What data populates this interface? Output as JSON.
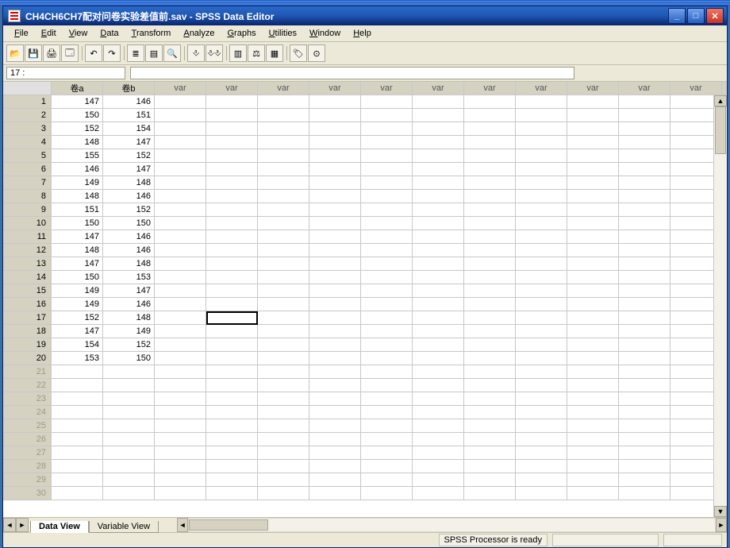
{
  "title": "CH4CH6CH7配对问卷实验差值前.sav - SPSS Data Editor",
  "menus": [
    "File",
    "Edit",
    "View",
    "Data",
    "Transform",
    "Analyze",
    "Graphs",
    "Utilities",
    "Window",
    "Help"
  ],
  "cellref": "17 :",
  "columns": [
    "卷a",
    "卷b"
  ],
  "extra_var_cols": 12,
  "extra_var_label": "var",
  "rows": [
    {
      "a": 147,
      "b": 146
    },
    {
      "a": 150,
      "b": 151
    },
    {
      "a": 152,
      "b": 154
    },
    {
      "a": 148,
      "b": 147
    },
    {
      "a": 155,
      "b": 152
    },
    {
      "a": 146,
      "b": 147
    },
    {
      "a": 149,
      "b": 148
    },
    {
      "a": 148,
      "b": 146
    },
    {
      "a": 151,
      "b": 152
    },
    {
      "a": 150,
      "b": 150
    },
    {
      "a": 147,
      "b": 146
    },
    {
      "a": 148,
      "b": 146
    },
    {
      "a": 147,
      "b": 148
    },
    {
      "a": 150,
      "b": 153
    },
    {
      "a": 149,
      "b": 147
    },
    {
      "a": 149,
      "b": 146
    },
    {
      "a": 152,
      "b": 148
    },
    {
      "a": 147,
      "b": 149
    },
    {
      "a": 154,
      "b": 152
    },
    {
      "a": 153,
      "b": 150
    }
  ],
  "empty_rows_after": 10,
  "selected_cell": {
    "row": 17,
    "col": 4
  },
  "tabs": {
    "active": "Data View",
    "inactive": "Variable View"
  },
  "status": "SPSS Processor  is ready",
  "toolbar_icons": [
    "open",
    "save",
    "print",
    "dialog-recall",
    "undo",
    "redo",
    "goto-case",
    "variables",
    "find",
    "insert-case",
    "insert-var",
    "split-file",
    "weight",
    "select-cases",
    "value-labels",
    "use-sets"
  ]
}
